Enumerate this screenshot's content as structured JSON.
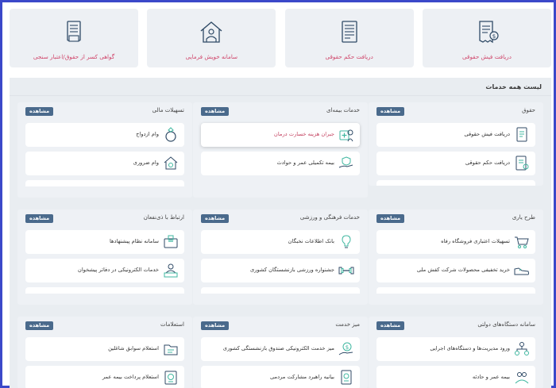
{
  "colors": {
    "accent": "#d0456a",
    "icon_teal": "#3fb7a0",
    "icon_navy": "#2f4a66",
    "button": "#4a6a8c",
    "frame": "#3b48c9"
  },
  "top_cards": [
    {
      "label": "دریافت فیش حقوقی",
      "icon": "receipt-icon"
    },
    {
      "label": "دریافت حکم حقوقی",
      "icon": "document-icon"
    },
    {
      "label": "سامانه خویش فرمایی",
      "icon": "house-worker-icon"
    },
    {
      "label": "گواهی کسر از حقوق/اعتبار سنجی",
      "icon": "certificate-icon"
    }
  ],
  "panel": {
    "title": "لیست همه خدمات",
    "view_label": "مشاهده"
  },
  "categories": [
    {
      "title": "حقوق",
      "items": [
        {
          "label": "دریافت فیش حقوقی",
          "icon": "payslip-icon"
        },
        {
          "label": "دریافت حکم حقوقی",
          "icon": "decree-icon"
        }
      ]
    },
    {
      "title": "خدمات بیمه‌ای",
      "items": [
        {
          "label": "جبران هزینه خسارت درمان",
          "icon": "medical-expense-icon"
        },
        {
          "label": "بیمه تکمیلی عمر و حوادث",
          "icon": "insurance-hand-icon"
        }
      ]
    },
    {
      "title": "تسهیلات مالی",
      "items": [
        {
          "label": "وام ازدواج",
          "icon": "ring-icon"
        },
        {
          "label": "وام ضروری",
          "icon": "loan-house-icon"
        }
      ]
    },
    {
      "title": "طرح یاری",
      "items": [
        {
          "label": "تسهیلات اعتباری فروشگاه رفاه",
          "icon": "shop-cart-icon"
        },
        {
          "label": "خرید تخفیفی محصولات شرکت کفش ملی",
          "icon": "shoe-icon"
        }
      ]
    },
    {
      "title": "خدمات فرهنگی و ورزشی",
      "items": [
        {
          "label": "بانک اطلاعات نخبگان",
          "icon": "lightbulb-icon"
        },
        {
          "label": "جشنواره ورزشی بازنشستگان کشوری",
          "icon": "dumbbell-icon"
        }
      ]
    },
    {
      "title": "ارتباط با ذی‌نفعان",
      "items": [
        {
          "label": "سامانه نظام پیشنهادها",
          "icon": "suggestion-box-icon"
        },
        {
          "label": "خدمات الکترونیکی در دفاتر پیشخوان",
          "icon": "counter-service-icon"
        }
      ]
    },
    {
      "title": "سامانه دستگاه‌های دولتی",
      "items": [
        {
          "label": "ورود مدیریت‌ها و دستگاه‌های اجرایی",
          "icon": "org-network-icon"
        },
        {
          "label": "بیمه عمر و حادثه",
          "icon": "family-insurance-icon"
        }
      ]
    },
    {
      "title": "میز خدمت",
      "items": [
        {
          "label": "میز خدمت الکترونیکی صندوق بازنشستگی کشوری",
          "icon": "service-desk-icon"
        },
        {
          "label": "بیانیه راهبرد مشارکت مردمی",
          "icon": "statement-icon"
        }
      ]
    },
    {
      "title": "استعلامات",
      "items": [
        {
          "label": "استعلام سوابق شاغلین",
          "icon": "records-folder-icon"
        },
        {
          "label": "استعلام پرداخت بیمه عمر",
          "icon": "payment-inquiry-icon"
        }
      ]
    }
  ]
}
